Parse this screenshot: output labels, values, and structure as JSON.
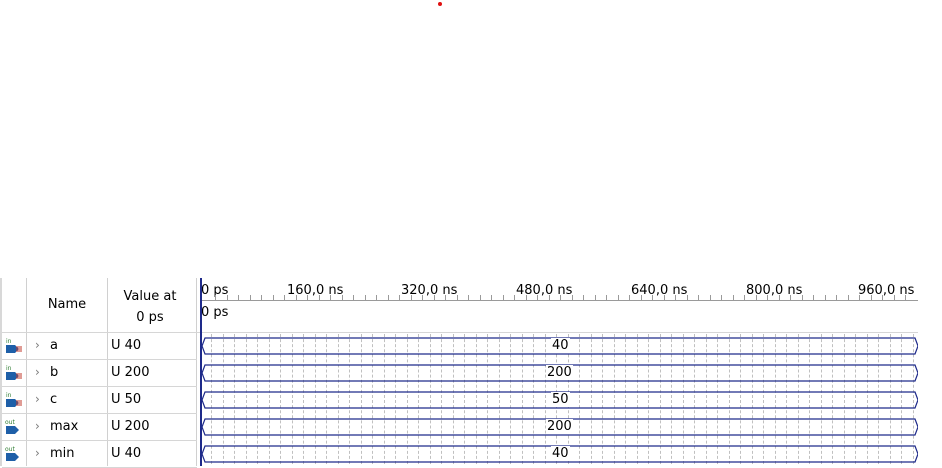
{
  "waveform": {
    "header": {
      "name": "Name",
      "value_line1": "Value at",
      "value_line2": "0 ps"
    },
    "timeline": {
      "labels": [
        "0 ps",
        "160,0 ns",
        "320,0 ns",
        "480,0 ns",
        "640,0 ns",
        "800,0 ns",
        "960,0 ns"
      ],
      "cursor_label": "0 ps"
    },
    "signals": [
      {
        "name": "a",
        "value": "U 40",
        "bus_value": "40",
        "direction": "in",
        "icon": "input-pin-icon"
      },
      {
        "name": "b",
        "value": "U 200",
        "bus_value": "200",
        "direction": "in",
        "icon": "input-pin-icon"
      },
      {
        "name": "c",
        "value": "U 50",
        "bus_value": "50",
        "direction": "in",
        "icon": "input-pin-icon"
      },
      {
        "name": "max",
        "value": "U 200",
        "bus_value": "200",
        "direction": "out",
        "icon": "output-pin-icon"
      },
      {
        "name": "min",
        "value": "U 40",
        "bus_value": "40",
        "direction": "out",
        "icon": "output-pin-icon"
      }
    ],
    "colors": {
      "bus_line": "#1e2a8a",
      "cursor": "#1e2a8a",
      "marker_dot": "#e01010"
    }
  }
}
